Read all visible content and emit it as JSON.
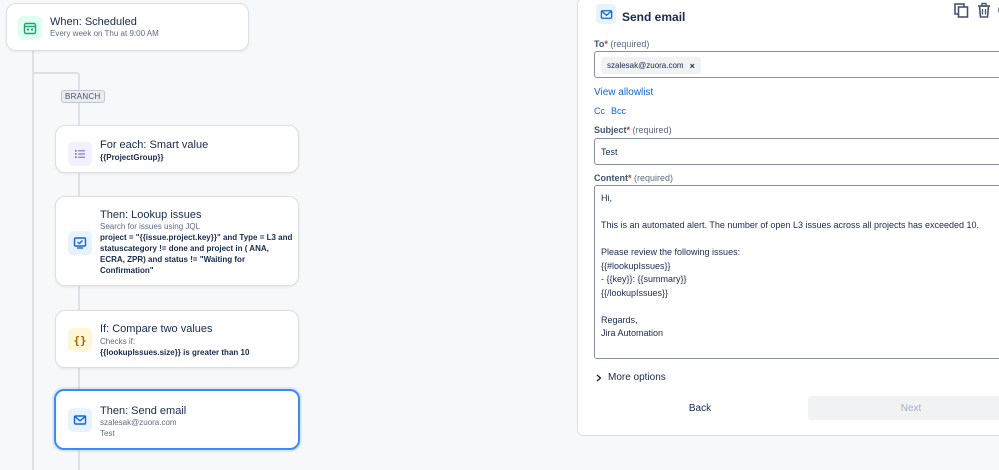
{
  "trigger": {
    "title": "When: Scheduled",
    "subtitle": "Every week on Thu at 9:00 AM"
  },
  "branch_label": "BRANCH",
  "steps": [
    {
      "title": "For each: Smart value",
      "detail": "{{ProjectGroup}}"
    },
    {
      "title": "Then: Lookup issues",
      "subtitle": "Search for issues using JQL",
      "detail_lines": [
        "project = \"{{issue.project.key}}\" and Type = L3 and",
        "statuscategory != done and project in ( ANA,",
        "ECRA, ZPR) and status != \"Waiting for",
        "Confirmation\""
      ]
    },
    {
      "title": "If: Compare two values",
      "subtitle": "Checks if:",
      "detail": "{{lookupIssues.size}} is greater than 10"
    },
    {
      "title": "Then: Send email",
      "subtitle": "szalesak@zuora.com",
      "detail": "Test"
    }
  ],
  "panel": {
    "title": "Send email",
    "to": {
      "label": "To",
      "required": "(required)",
      "chip": "szalesak@zuora.com",
      "chip_close": "×"
    },
    "view_allowlist": "View allowlist",
    "cc": "Cc",
    "bcc": "Bcc",
    "subject": {
      "label": "Subject",
      "required": "(required)",
      "value": "Test"
    },
    "content": {
      "label": "Content",
      "required": "(required)",
      "value": "Hi,\n\nThis is an automated alert. The number of open L3 issues across all projects has exceeded 10.\n\nPlease review the following issues:\n{{#lookupIssues}}\n- {{key}}: {{summary}}\n{{/lookupIssues}}\n\nRegards,\nJira Automation"
    },
    "more_options": "More options",
    "back": "Back",
    "next": "Next"
  },
  "colors": {
    "accent": "#0c66e4",
    "selected_border": "#388bff",
    "required": "#c9372c"
  }
}
